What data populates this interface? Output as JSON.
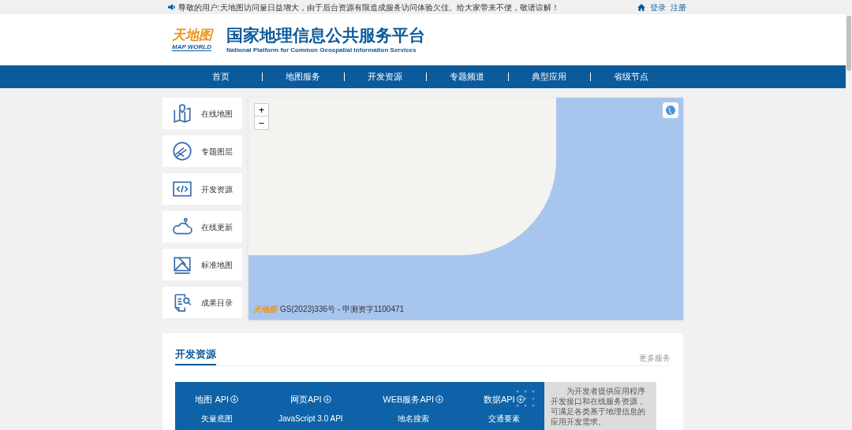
{
  "notice_bar": {
    "message": "尊敬的用户:天地图访问量日益增大，由于后台资源有限造成服务访问体验欠佳。给大家带来不便，敬请谅解！",
    "links": [
      "登录",
      "注册"
    ]
  },
  "header": {
    "logo_text": "天地图",
    "logo_subtext": "MAP WORLD",
    "title": "国家地理信息公共服务平台",
    "subtitle": "National Platform for Common Geospatial Information Services"
  },
  "nav": [
    {
      "label": "首页"
    },
    {
      "label": "地图服务"
    },
    {
      "label": "开发资源"
    },
    {
      "label": "专题频道"
    },
    {
      "label": "典型应用"
    },
    {
      "label": "省级节点"
    }
  ],
  "side_menu": [
    {
      "kind": "map",
      "label": "在线地图"
    },
    {
      "kind": "layers",
      "label": "专题图层"
    },
    {
      "kind": "code",
      "label": "开发资源"
    },
    {
      "kind": "update",
      "label": "在线更新"
    },
    {
      "kind": "standard",
      "label": "标准地图"
    },
    {
      "kind": "catalog",
      "label": "成果目录"
    }
  ],
  "map": {
    "zoom_in": "+",
    "zoom_out": "−",
    "logo_text": "天地图",
    "attribution": "GS(2023)336号 - 甲测资字1100471"
  },
  "dev_section": {
    "title": "开发资源",
    "more": "更多服务",
    "apis": [
      {
        "name": "地图 API",
        "item": "矢量底图"
      },
      {
        "name": "网页API",
        "item": "JavaScript 3.0 API"
      },
      {
        "name": "WEB服务API",
        "item": "地名搜索"
      },
      {
        "name": "数据API",
        "item": "交通要素"
      }
    ],
    "description": "为开发者提供应用程序开发接口和在线服务资源，可满足各类基于地理信息的应用开发需求。"
  }
}
